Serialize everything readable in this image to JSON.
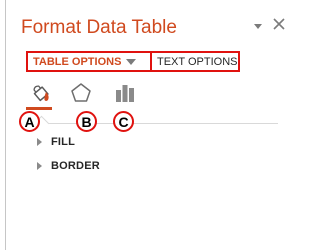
{
  "pane": {
    "title": "Format Data Table"
  },
  "tabs": {
    "table_options": "TABLE OPTIONS",
    "text_options": "TEXT OPTIONS"
  },
  "category_icons": [
    {
      "name": "fill-line-icon",
      "badge": "A"
    },
    {
      "name": "effects-icon",
      "badge": "B"
    },
    {
      "name": "size-properties-icon",
      "badge": "C"
    }
  ],
  "sections": [
    {
      "label": "FILL"
    },
    {
      "label": "BORDER"
    }
  ],
  "colors": {
    "accent": "#d04a1f",
    "highlight": "#e0120f"
  }
}
